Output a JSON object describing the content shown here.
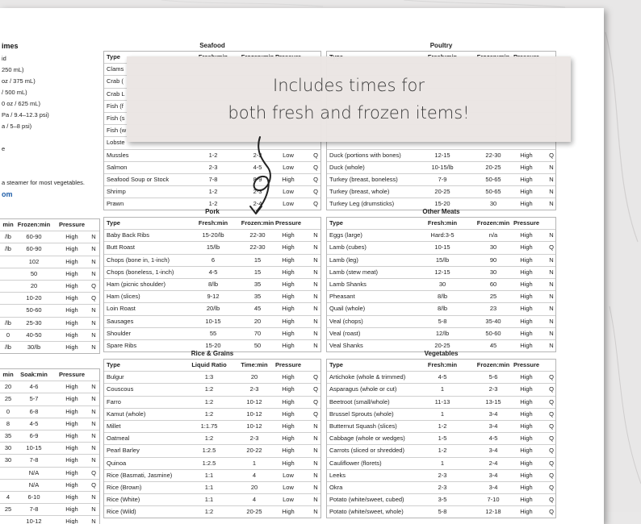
{
  "overlay": {
    "line1": "Includes times for",
    "line2": "both fresh and frozen items!"
  },
  "left": {
    "heading": "imes",
    "lines": [
      "id",
      "250 mL)",
      "oz / 375 mL)",
      "/ 500 mL)",
      "0 oz / 625 mL)",
      "Pa / 9.4–12.3 psi)",
      "a / 5–8 psi)",
      "",
      "e",
      "",
      "",
      "a steamer for most vegetables."
    ],
    "link": "om",
    "meat_header": [
      "min",
      "Frozen:min",
      "Pressure"
    ],
    "meat_rows": [
      [
        "/lb",
        "60-90",
        "High",
        "N"
      ],
      [
        "/lb",
        "60-90",
        "High",
        "N"
      ],
      [
        "",
        "102",
        "High",
        "N"
      ],
      [
        "",
        "50",
        "High",
        "N"
      ],
      [
        "",
        "20",
        "High",
        "Q"
      ],
      [
        "",
        "10-20",
        "High",
        "Q"
      ],
      [
        "",
        "50-60",
        "High",
        "N"
      ],
      [
        "/lb",
        "25-30",
        "High",
        "N"
      ],
      [
        "0",
        "40-50",
        "High",
        "N"
      ],
      [
        "/lb",
        "30/lb",
        "High",
        "N"
      ]
    ],
    "beans_header": [
      "min",
      "Soak:min",
      "Pressure"
    ],
    "beans_rows": [
      [
        "20",
        "4-6",
        "High",
        "N"
      ],
      [
        "25",
        "5-7",
        "High",
        "N"
      ],
      [
        "0",
        "6-8",
        "High",
        "N"
      ],
      [
        "8",
        "4-5",
        "High",
        "N"
      ],
      [
        "35",
        "6-9",
        "High",
        "N"
      ],
      [
        "30",
        "10-15",
        "High",
        "N"
      ],
      [
        "30",
        "7-8",
        "High",
        "N"
      ],
      [
        "",
        "N/A",
        "High",
        "Q"
      ],
      [
        "",
        "N/A",
        "High",
        "Q"
      ],
      [
        "4",
        "6-10",
        "High",
        "N"
      ],
      [
        "25",
        "7-8",
        "High",
        "N"
      ],
      [
        "",
        "10-12",
        "High",
        "N"
      ]
    ]
  },
  "seafood": {
    "title": "Seafood",
    "header": [
      "Type",
      "Fresh:min",
      "Frozen:min",
      "Pressure",
      ""
    ],
    "rows": [
      [
        "Clams",
        "",
        "",
        "",
        ""
      ],
      [
        "Crab (",
        "",
        "",
        "",
        ""
      ],
      [
        "Crab L",
        "",
        "",
        "",
        ""
      ],
      [
        "Fish (f",
        "",
        "",
        "",
        ""
      ],
      [
        "Fish (s",
        "",
        "",
        "",
        ""
      ],
      [
        "Fish (w",
        "",
        "",
        "",
        ""
      ],
      [
        "Lobste",
        "",
        "",
        "",
        ""
      ],
      [
        "Mussles",
        "1-2",
        "2-3",
        "Low",
        "Q"
      ],
      [
        "Salmon",
        "2-3",
        "4-5",
        "Low",
        "Q"
      ],
      [
        "Seafood Soup or Stock",
        "7-8",
        "8-9",
        "High",
        "Q"
      ],
      [
        "Shrimp",
        "1-2",
        "2-3",
        "Low",
        "Q"
      ],
      [
        "Prawn",
        "1-2",
        "2-4",
        "Low",
        "Q"
      ]
    ]
  },
  "poultry": {
    "title": "Poultry",
    "header": [
      "Type",
      "Fresh:min",
      "Frozen:min",
      "Pressure",
      ""
    ],
    "rows": [
      [
        "",
        "",
        "",
        "",
        ""
      ],
      [
        "",
        "",
        "",
        "",
        ""
      ],
      [
        "",
        "",
        "",
        "",
        ""
      ],
      [
        "",
        "",
        "",
        "",
        ""
      ],
      [
        "",
        "",
        "",
        "",
        ""
      ],
      [
        "",
        "",
        "",
        "",
        ""
      ],
      [
        "",
        "",
        "",
        "",
        ""
      ],
      [
        "Duck (portions with bones)",
        "12-15",
        "22-30",
        "High",
        "Q"
      ],
      [
        "Duck (whole)",
        "10-15/lb",
        "20-25",
        "High",
        "N"
      ],
      [
        "Turkey (breast, boneless)",
        "7-9",
        "50-65",
        "High",
        "N"
      ],
      [
        "Turkey (breast, whole)",
        "20-25",
        "50-65",
        "High",
        "N"
      ],
      [
        "Turkey Leg (drumsticks)",
        "15-20",
        "30",
        "High",
        "N"
      ]
    ]
  },
  "pork": {
    "title": "Pork",
    "header": [
      "Type",
      "Fresh:min",
      "Frozen:min",
      "Pressure",
      ""
    ],
    "rows": [
      [
        "Baby Back Ribs",
        "15-20/lb",
        "22-30",
        "High",
        "N"
      ],
      [
        "Butt Roast",
        "15/lb",
        "22-30",
        "High",
        "N"
      ],
      [
        "Chops (bone in, 1-inch)",
        "6",
        "15",
        "High",
        "N"
      ],
      [
        "Chops (boneless, 1-inch)",
        "4-5",
        "15",
        "High",
        "N"
      ],
      [
        "Ham (picnic shoulder)",
        "8/lb",
        "35",
        "High",
        "N"
      ],
      [
        "Ham (slices)",
        "9-12",
        "35",
        "High",
        "N"
      ],
      [
        "Loin Roast",
        "20/lb",
        "45",
        "High",
        "N"
      ],
      [
        "Sausages",
        "10-15",
        "20",
        "High",
        "N"
      ],
      [
        "Shoulder",
        "55",
        "70",
        "High",
        "N"
      ],
      [
        "Spare Ribs",
        "15-20",
        "50",
        "High",
        "N"
      ]
    ]
  },
  "other_meats": {
    "title": "Other Meats",
    "header": [
      "Type",
      "Fresh:min",
      "Frozen:min",
      "Pressure",
      ""
    ],
    "rows": [
      [
        "Eggs (large)",
        "Hard:3-5",
        "n/a",
        "High",
        "N"
      ],
      [
        "Lamb (cubes)",
        "10-15",
        "30",
        "High",
        "Q"
      ],
      [
        "Lamb (leg)",
        "15/lb",
        "90",
        "High",
        "N"
      ],
      [
        "Lamb (stew meat)",
        "12-15",
        "30",
        "High",
        "N"
      ],
      [
        "Lamb Shanks",
        "30",
        "60",
        "High",
        "N"
      ],
      [
        "Pheasant",
        "8/lb",
        "25",
        "High",
        "N"
      ],
      [
        "Quail (whole)",
        "8/lb",
        "23",
        "High",
        "N"
      ],
      [
        "Veal (chops)",
        "5-8",
        "35-40",
        "High",
        "N"
      ],
      [
        "Veal (roast)",
        "12/lb",
        "50-60",
        "High",
        "N"
      ],
      [
        "Veal Shanks",
        "20-25",
        "45",
        "High",
        "N"
      ]
    ]
  },
  "rice_grains": {
    "title": "Rice & Grains",
    "header": [
      "Type",
      "Liquid Ratio",
      "Time:min",
      "Pressure",
      ""
    ],
    "rows": [
      [
        "Bulgur",
        "1:3",
        "20",
        "High",
        "Q"
      ],
      [
        "Couscous",
        "1:2",
        "2-3",
        "High",
        "Q"
      ],
      [
        "Farro",
        "1:2",
        "10-12",
        "High",
        "Q"
      ],
      [
        "Kamut (whole)",
        "1:2",
        "10-12",
        "High",
        "Q"
      ],
      [
        "Millet",
        "1:1.75",
        "10-12",
        "High",
        "N"
      ],
      [
        "Oatmeal",
        "1:2",
        "2-3",
        "High",
        "N"
      ],
      [
        "Pearl Barley",
        "1:2.5",
        "20-22",
        "High",
        "N"
      ],
      [
        "Quinoa",
        "1:2.5",
        "1",
        "High",
        "N"
      ],
      [
        "Rice (Basmati, Jasmine)",
        "1:1",
        "4",
        "Low",
        "N"
      ],
      [
        "Rice (Brown)",
        "1:1",
        "20",
        "Low",
        "N"
      ],
      [
        "Rice (White)",
        "1:1",
        "4",
        "Low",
        "N"
      ],
      [
        "Rice (Wild)",
        "1:2",
        "20-25",
        "High",
        "N"
      ]
    ]
  },
  "vegetables": {
    "title": "Vegetables",
    "header": [
      "Type",
      "Fresh:min",
      "Frozen:min",
      "Pressure",
      ""
    ],
    "rows": [
      [
        "Artichoke (whole & trimmed)",
        "4-5",
        "5-6",
        "High",
        "Q"
      ],
      [
        "Asparagus (whole or cut)",
        "1",
        "2-3",
        "High",
        "Q"
      ],
      [
        "Beetroot (small/whole)",
        "11-13",
        "13-15",
        "High",
        "Q"
      ],
      [
        "Brussel Sprouts (whole)",
        "1",
        "3-4",
        "High",
        "Q"
      ],
      [
        "Butternut Squash (slices)",
        "1-2",
        "3-4",
        "High",
        "Q"
      ],
      [
        "Cabbage (whole or wedges)",
        "1-5",
        "4-5",
        "High",
        "Q"
      ],
      [
        "Carrots (sliced or shredded)",
        "1-2",
        "3-4",
        "High",
        "Q"
      ],
      [
        "Cauliflower (florets)",
        "1",
        "2-4",
        "High",
        "Q"
      ],
      [
        "Leeks",
        "2-3",
        "3-4",
        "High",
        "Q"
      ],
      [
        "Okra",
        "2-3",
        "3-4",
        "High",
        "Q"
      ],
      [
        "Potato (white/sweet, cubed)",
        "3-5",
        "7-10",
        "High",
        "Q"
      ],
      [
        "Potato (white/sweet, whole)",
        "5-8",
        "12-18",
        "High",
        "Q"
      ]
    ]
  }
}
